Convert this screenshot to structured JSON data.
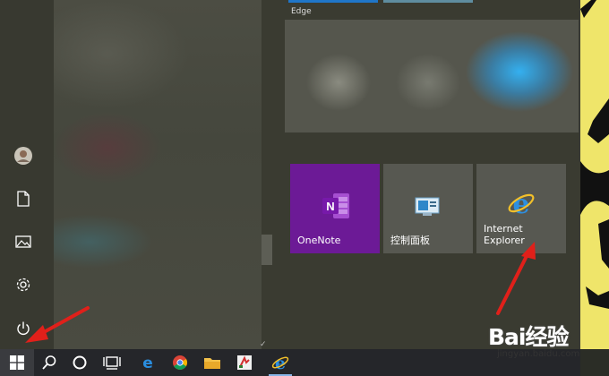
{
  "tiles": {
    "top_label": "Edge",
    "onenote": {
      "label": "OneNote",
      "color": "#6c1a96"
    },
    "control_panel": {
      "label": "控制面板"
    },
    "ie": {
      "label": "Internet\nExplorer"
    }
  },
  "rail_icons": [
    "avatar",
    "document-icon",
    "pictures-icon",
    "gear-icon",
    "power-icon"
  ],
  "taskbar_icons": [
    "windows-logo-icon",
    "search-icon",
    "cortana-icon",
    "task-view-icon",
    "edge-icon",
    "chrome-icon",
    "file-explorer-icon",
    "pinned-app-icon",
    "ie-icon"
  ],
  "watermark": {
    "logo": "Bai经验",
    "url": "jingyan.baidu.com"
  },
  "colors": {
    "accent_arrow": "#e0201a",
    "taskbar": "#25262a",
    "wallpaper": "#efe56a"
  }
}
